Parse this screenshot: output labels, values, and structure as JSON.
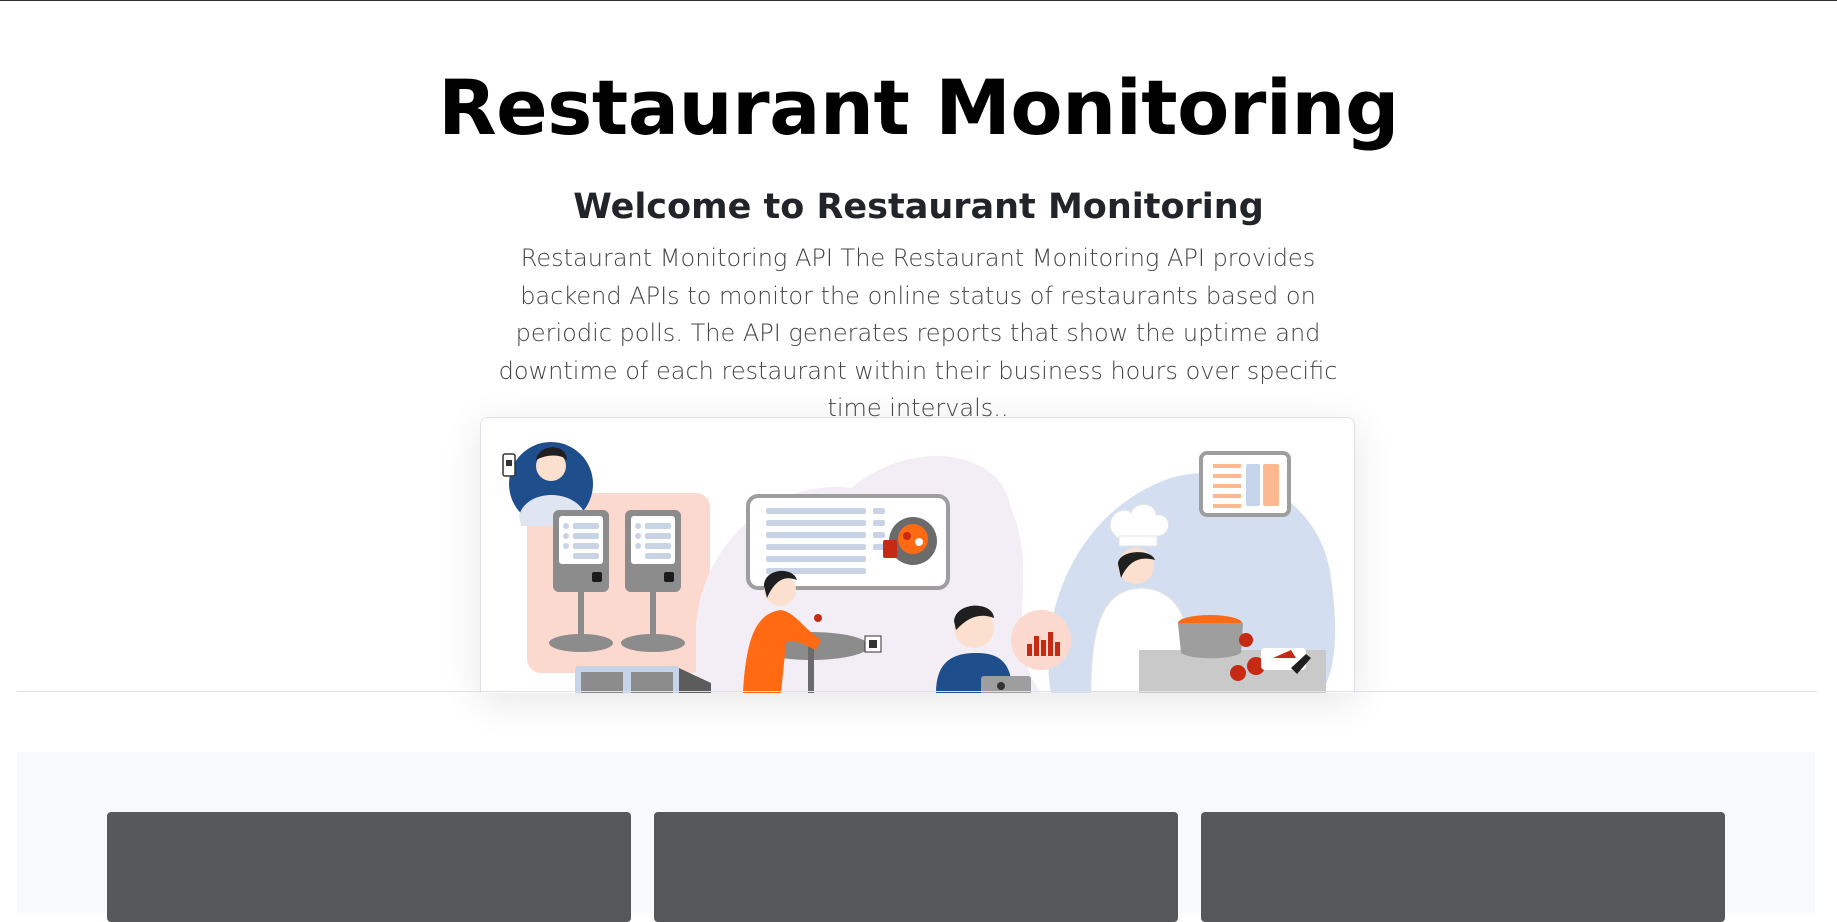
{
  "page": {
    "title": "Restaurant Monitoring",
    "subtitle": "Welcome to Restaurant Monitoring",
    "lead": "Restaurant Monitoring API The Restaurant Monitoring API provides backend APIs to monitor the online status of restaurants based on periodic polls. The API generates reports that show the uptime and downtime of each restaurant within their business hours over specific time intervals.."
  },
  "colors": {
    "card_bg": "#55595c",
    "section_bg": "#f8f9fa",
    "accent_orange": "#ff6a13",
    "accent_blue_light": "#d3dff0",
    "accent_peach": "#fcd9cf"
  },
  "illustration": {
    "name": "restaurant-monitoring-illustration"
  },
  "features": {
    "cards": [
      {
        "id": "card-1"
      },
      {
        "id": "card-2"
      },
      {
        "id": "card-3"
      }
    ]
  }
}
